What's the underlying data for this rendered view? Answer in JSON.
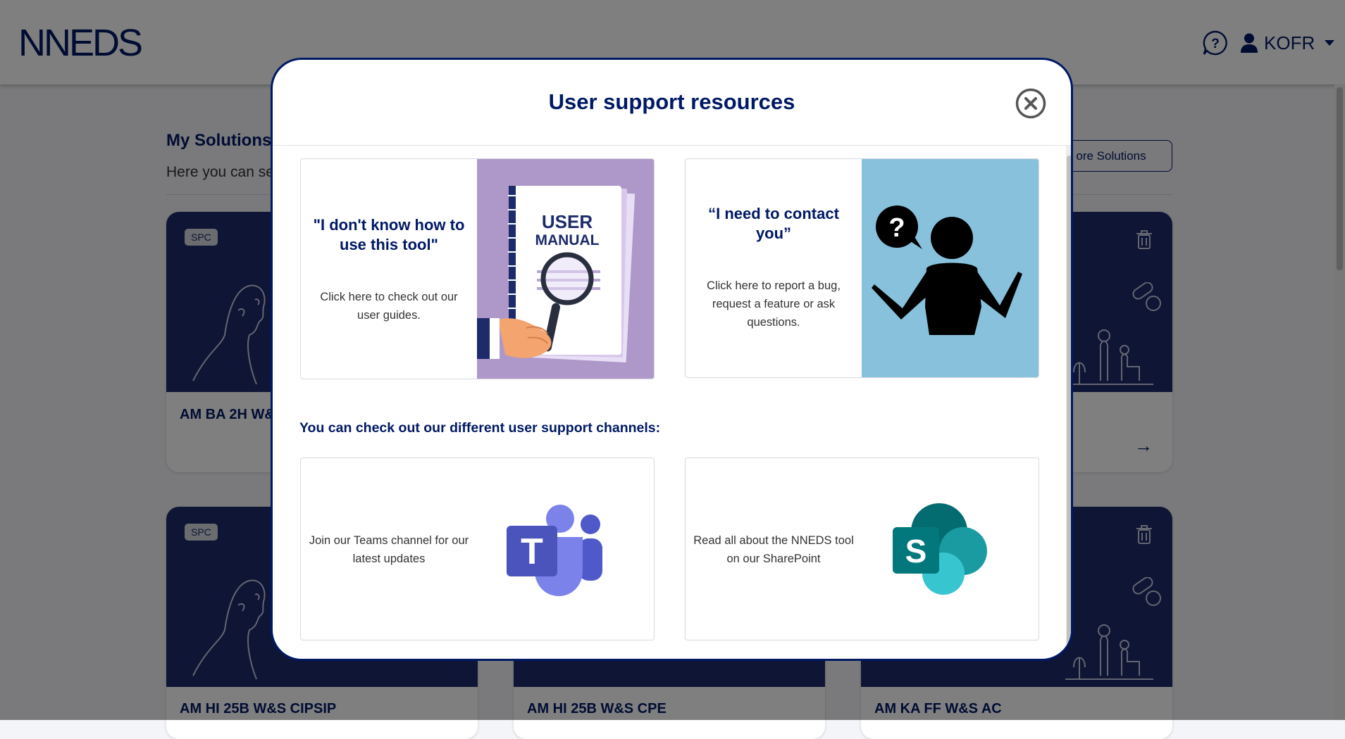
{
  "app": {
    "logo": "NNEDS",
    "user_label": "KOFR"
  },
  "page": {
    "heading": "My Solutions",
    "subtitle": "Here you can see",
    "more_button": "ore Solutions"
  },
  "cards": [
    {
      "badge": "SPC",
      "title": "AM BA 2H W&S"
    },
    {
      "badge": "SPC",
      "title": "AM HI 25B W&S CIPSIP"
    },
    {
      "badge": "",
      "title": "AM HI 25B W&S CPE"
    },
    {
      "badge": "",
      "title": "AM KA FF W&S AC"
    }
  ],
  "modal": {
    "title": "User support resources",
    "resources": [
      {
        "quote": "\"I don't know how to use this tool\"",
        "desc": "Click here to check out our user guides.",
        "image_title": [
          "USER",
          "MANUAL"
        ]
      },
      {
        "quote": "“I need to contact you”",
        "desc": "Click here to report a bug, request a feature or ask questions."
      }
    ],
    "channels_heading": "You can check out our different user support channels:",
    "channels": [
      {
        "text": "Join our Teams channel for our latest updates",
        "logo_letter": "T",
        "icon": "teams-logo"
      },
      {
        "text": "Read all about the NNEDS tool on our SharePoint",
        "logo_letter": "S",
        "icon": "sharepoint-logo"
      }
    ]
  },
  "colors": {
    "brand_navy": "#001965",
    "card_navy": "#1d2b6b",
    "manual_bg": "#ad98c9",
    "contact_bg": "#88c1dc"
  }
}
